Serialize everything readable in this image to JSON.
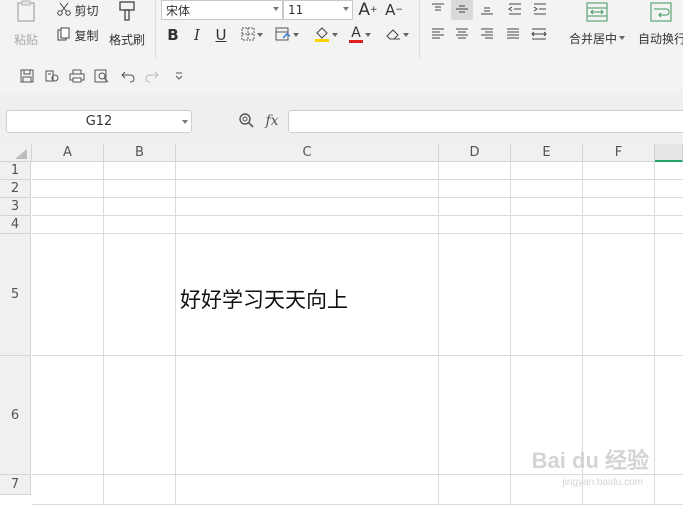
{
  "ribbon": {
    "paste_label": "粘贴",
    "cut_label": "剪切",
    "copy_label": "复制",
    "format_painter_label": "格式刷",
    "font_name": "宋体",
    "font_size": "11",
    "increase_font": "A",
    "decrease_font": "A",
    "bold": "B",
    "italic": "I",
    "underline": "U",
    "font_color_letter": "A",
    "merge_center_label": "合并居中",
    "wrap_text_label": "自动换行",
    "accent_colors": {
      "fill_yellow": "#f5d400",
      "font_red": "#e02020"
    }
  },
  "quick_access": {
    "icons": [
      "save-icon",
      "save-as-icon",
      "print-icon",
      "print-preview-icon",
      "undo-icon",
      "redo-icon",
      "customize-icon"
    ]
  },
  "formula_bar": {
    "name_box_value": "G12",
    "fx_label": "fx",
    "formula_value": ""
  },
  "sheet": {
    "columns": [
      "A",
      "B",
      "C",
      "D",
      "E",
      "F"
    ],
    "rows": [
      "1",
      "2",
      "3",
      "4",
      "5",
      "6",
      "7"
    ],
    "cell_C5": "好好学习天天向上",
    "selected_column_accent": "#21a366"
  },
  "watermark": {
    "brand": "Bai du 经验",
    "url": "jingyan.baidu.com"
  }
}
